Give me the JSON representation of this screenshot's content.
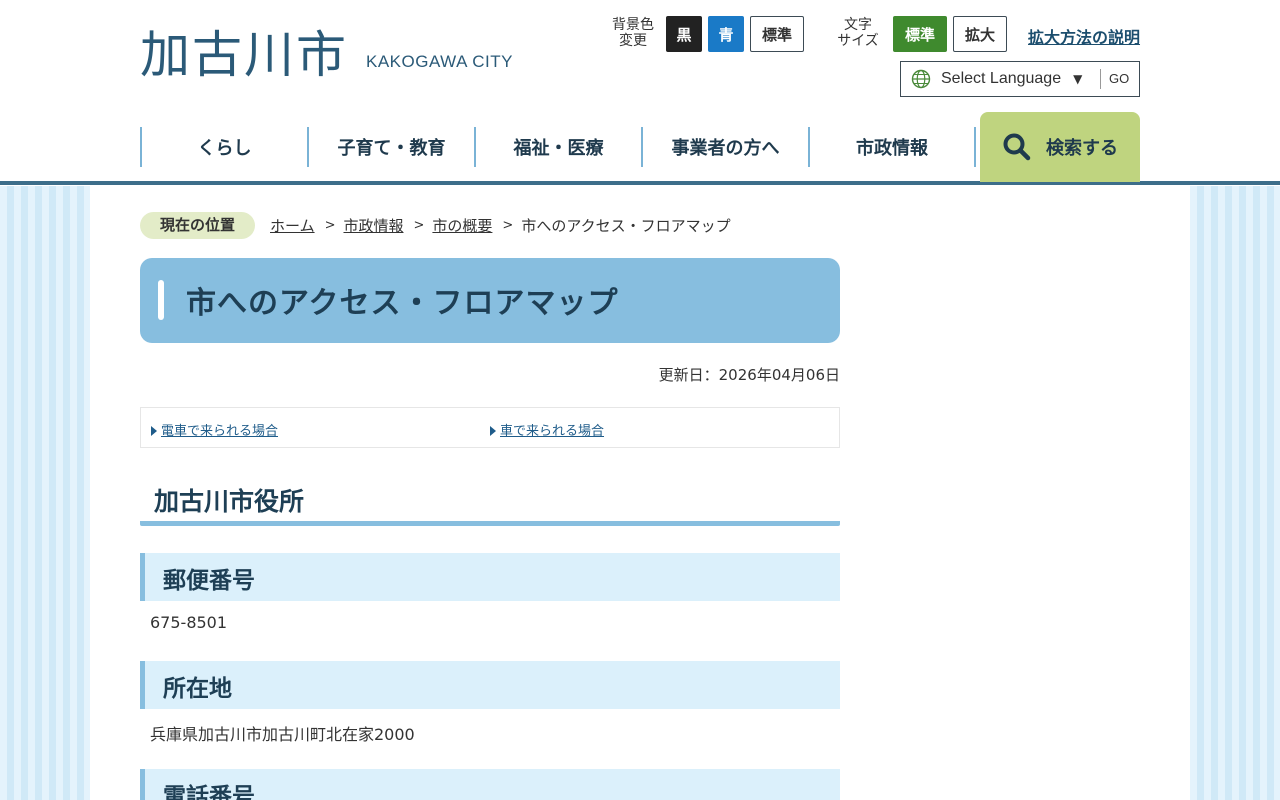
{
  "header": {
    "logo_jp": "加古川市",
    "logo_en": "KAKOGAWA CITY",
    "bg_color": {
      "label_line1": "背景色",
      "label_line2": "変更",
      "options": [
        "黒",
        "青",
        "標準"
      ]
    },
    "text_size": {
      "label_line1": "文字",
      "label_line2": "サイズ",
      "options": [
        "標準",
        "拡大"
      ]
    },
    "zoom_help_link": "拡大方法の説明",
    "language": {
      "selected": "Select Language",
      "go_label": "GO"
    }
  },
  "nav": {
    "items": [
      "くらし",
      "子育て・教育",
      "福祉・医療",
      "事業者の方へ",
      "市政情報"
    ],
    "search_label": "検索する"
  },
  "breadcrumb": {
    "label": "現在の位置",
    "links": [
      "ホーム",
      "市政情報",
      "市の概要"
    ],
    "current": "市へのアクセス・フロアマップ"
  },
  "page": {
    "title": "市へのアクセス・フロアマップ",
    "updated": "更新日：2026年04月06日",
    "toc": [
      "電車で来られる場合",
      "車で来られる場合"
    ],
    "section_title": "加古川市役所",
    "sections": [
      {
        "heading": "郵便番号",
        "text": "675-8501"
      },
      {
        "heading": "所在地",
        "text": "兵庫県加古川市加古川町北在家2000"
      },
      {
        "heading": "電話番号",
        "text": ""
      }
    ]
  },
  "colors": {
    "brand": "#2b5a78",
    "nav_border": "#7ab3d6",
    "search_bg": "#bfd47f",
    "title_bg": "#87bedf",
    "heading_bg": "#dbf0fb"
  }
}
